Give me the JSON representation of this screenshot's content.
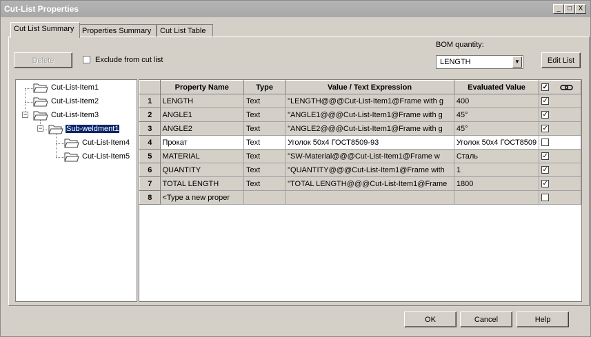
{
  "window": {
    "title": "Cut-List Properties",
    "controls": {
      "minimize": "_",
      "maximize": "□",
      "close": "X"
    }
  },
  "tabs": [
    {
      "label": "Cut List Summary"
    },
    {
      "label": "Properties Summary"
    },
    {
      "label": "Cut List Table"
    }
  ],
  "toolbar": {
    "delete_label": "Delete",
    "exclude_label": "Exclude from cut list",
    "bom_quantity_label": "BOM quantity:",
    "bom_quantity_value": "LENGTH",
    "edit_list_label": "Edit List"
  },
  "tree": {
    "items": [
      {
        "label": "Cut-List-Item1"
      },
      {
        "label": "Cut-List-Item2"
      },
      {
        "label": "Cut-List-Item3",
        "expander": "−"
      },
      {
        "label": "Sub-weldment1",
        "expander": "−",
        "selected": true
      },
      {
        "label": "Cut-List-Item4"
      },
      {
        "label": "Cut-List-Item5"
      }
    ]
  },
  "table": {
    "headers": {
      "property_name": "Property Name",
      "type": "Type",
      "value": "Value / Text Expression",
      "evaluated": "Evaluated Value",
      "link_icon": "link-icon"
    },
    "rows": [
      {
        "num": "1",
        "name": "LENGTH",
        "type": "Text",
        "value": "\"LENGTH@@@Cut-List-Item1@Frame with g",
        "evaluated": "400",
        "checked": "✓"
      },
      {
        "num": "2",
        "name": "ANGLE1",
        "type": "Text",
        "value": "\"ANGLE1@@@Cut-List-Item1@Frame with g",
        "evaluated": "45°",
        "checked": "✓"
      },
      {
        "num": "3",
        "name": "ANGLE2",
        "type": "Text",
        "value": "\"ANGLE2@@@Cut-List-Item1@Frame with g",
        "evaluated": "45°",
        "checked": "✓"
      },
      {
        "num": "4",
        "name": "Прокат",
        "type": "Text",
        "value": "Уголок 50x4 ГОСТ8509-93",
        "evaluated": "Уголок 50x4 ГОСТ8509",
        "checked": ""
      },
      {
        "num": "5",
        "name": "MATERIAL",
        "type": "Text",
        "value": "\"SW-Material@@@Cut-List-Item1@Frame w",
        "evaluated": "Сталь",
        "checked": "✓"
      },
      {
        "num": "6",
        "name": "QUANTITY",
        "type": "Text",
        "value": "\"QUANTITY@@@Cut-List-Item1@Frame with",
        "evaluated": "1",
        "checked": "✓"
      },
      {
        "num": "7",
        "name": "TOTAL LENGTH",
        "type": "Text",
        "value": "\"TOTAL LENGTH@@@Cut-List-Item1@Frame",
        "evaluated": "1800",
        "checked": "✓"
      },
      {
        "num": "8",
        "name": "<Type a new proper",
        "type": "",
        "value": "",
        "evaluated": "",
        "checked": ""
      }
    ]
  },
  "footer": {
    "ok_label": "OK",
    "cancel_label": "Cancel",
    "help_label": "Help"
  }
}
